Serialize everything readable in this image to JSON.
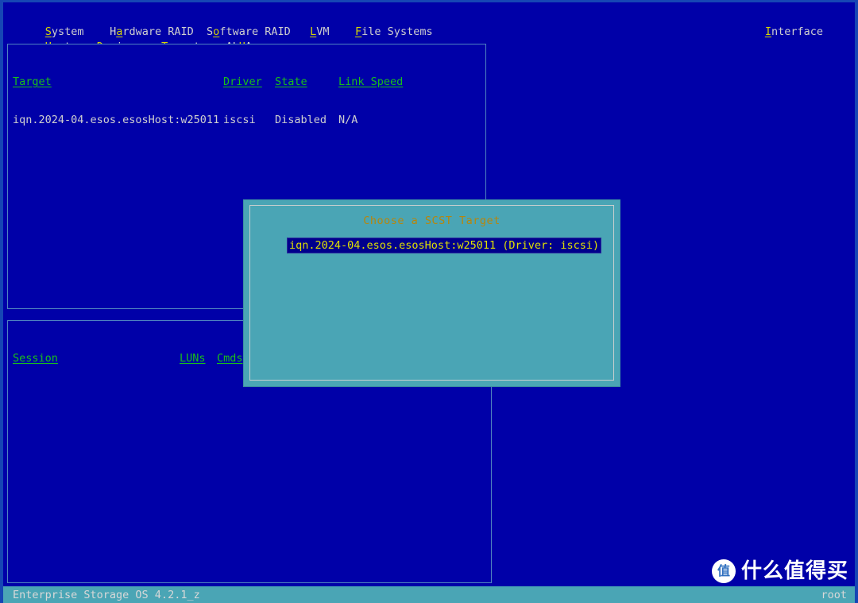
{
  "app": {
    "status_left": "Enterprise Storage OS 4.2.1_z",
    "status_right": "root",
    "colors": {
      "screen_bg": "#0000a8",
      "frame": "#1646b4",
      "panel_border": "#4f83c0",
      "header_green": "#18c018",
      "hotkey_yellow": "#d6d600",
      "text_gray": "#cfcfcf",
      "dialog_bg": "#4aa5b5",
      "dialog_title": "#b8860b",
      "selection_bg": "#00008c",
      "selection_fg": "#e0e000",
      "statusbar_bg": "#4aa5b5"
    }
  },
  "menubar": {
    "row1": [
      {
        "pre": "",
        "hot": "S",
        "post": "ystem",
        "gap": "    "
      },
      {
        "pre": "H",
        "hot": "a",
        "post": "rdware RAID",
        "gap": "  "
      },
      {
        "pre": "S",
        "hot": "o",
        "post": "ftware RAID",
        "gap": "   "
      },
      {
        "pre": "",
        "hot": "L",
        "post": "VM",
        "gap": "    "
      },
      {
        "pre": "",
        "hot": "F",
        "post": "ile Systems",
        "gap": ""
      }
    ],
    "row2": [
      {
        "pre": "",
        "hot": "H",
        "post": "osts",
        "gap": "   "
      },
      {
        "pre": "",
        "hot": "D",
        "post": "evices",
        "gap": "   "
      },
      {
        "pre": "",
        "hot": "T",
        "post": "argets",
        "gap": "   "
      },
      {
        "pre": "AL",
        "hot": "U",
        "post": "A",
        "gap": ""
      }
    ],
    "interface": {
      "pre": "",
      "hot": "I",
      "post": "nterface"
    }
  },
  "targets_panel": {
    "headers": [
      "Target",
      "Driver",
      "State",
      "Link Speed"
    ],
    "header_line": "Target                     Driver    State    Link Speed",
    "rows": [
      {
        "target": "iqn.2024-04.esos.esosHost:w25011",
        "driver": "iscsi",
        "state": "Disabled",
        "link_speed": "N/A",
        "line": "iqn.2024-04.esos.esosHost:w25011 iscsi     Disabled  N/A"
      }
    ]
  },
  "sessions_panel": {
    "headers": [
      "Session",
      "LUNs",
      "Cmds"
    ],
    "rows": []
  },
  "dialog": {
    "title": "Choose a SCST Target",
    "options": [
      {
        "label": "iqn.2024-04.esos.esosHost:w25011 (Driver: iscsi)",
        "selected": true
      }
    ]
  },
  "watermark": {
    "logo_glyph": "值",
    "text": "什么值得买"
  }
}
